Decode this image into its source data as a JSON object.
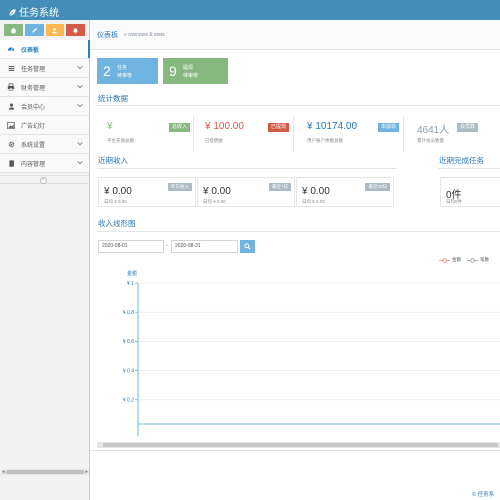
{
  "app": {
    "title": "任务系统"
  },
  "sidebar": {
    "shortcuts": [
      {
        "icon": "home-icon",
        "color": "#87b87f"
      },
      {
        "icon": "pencil-icon",
        "color": "#6fb3e0"
      },
      {
        "icon": "users-icon",
        "color": "#ffb752"
      },
      {
        "icon": "bell-icon",
        "color": "#d15b47"
      }
    ],
    "items": [
      {
        "label": "仪表板",
        "icon": "dashboard-icon",
        "active": true
      },
      {
        "label": "任务管理",
        "icon": "list-icon"
      },
      {
        "label": "财务管理",
        "icon": "print-icon"
      },
      {
        "label": "会员中心",
        "icon": "user-icon"
      },
      {
        "label": "广告幻灯",
        "icon": "picture-icon"
      },
      {
        "label": "系统设置",
        "icon": "gear-icon"
      },
      {
        "label": "内容管理",
        "icon": "book-icon"
      }
    ]
  },
  "breadcrumb": {
    "title": "仪表板",
    "subtitle": "» overview & stats"
  },
  "infoboxes": [
    {
      "number": "2",
      "title": "任务",
      "caption": "待审核",
      "color": "#6fb3e0"
    },
    {
      "number": "9",
      "title": "提现",
      "caption": "待审核",
      "color": "#87b87f"
    }
  ],
  "stats": {
    "title": "统计数据",
    "items": [
      {
        "value": "¥",
        "caption": "平台充值总额",
        "tag": "总收入",
        "color": "#87b87f"
      },
      {
        "value": "¥ 100.00",
        "caption": "已提佣金",
        "tag": "已提现",
        "color": "#d15b47"
      },
      {
        "value": "¥ 10174.00",
        "caption": "用户账户余额总额",
        "tag": "未提现",
        "color": "#6fb3e0"
      },
      {
        "value": "4641人",
        "caption": "累计会员数量",
        "tag": "会员数",
        "color": "#abbac3"
      }
    ]
  },
  "recent_income": {
    "title": "近期收入",
    "cards": [
      {
        "value": "¥ 0.00",
        "caption": "日均 ¥ 0.00",
        "tag": "昨日收入"
      },
      {
        "value": "¥ 0.00",
        "caption": "日均 ¥ 0.00",
        "tag": "最近7日"
      },
      {
        "value": "¥ 0.00",
        "caption": "日均 ¥ 0.00",
        "tag": "最近30日"
      }
    ]
  },
  "recent_tasks": {
    "title": "近期完成任务",
    "cards": [
      {
        "value": "0件",
        "caption": "日均0件"
      }
    ]
  },
  "trend": {
    "title": "收入线形图",
    "date_from": "2020-08-01",
    "date_sep": "-",
    "date_to": "2020-08-31",
    "legend": [
      "金额",
      "笔数"
    ]
  },
  "chart_data": {
    "type": "line",
    "title": "收入线形图",
    "ylabel": "金额",
    "ylim": [
      0,
      1
    ],
    "y_ticks": [
      "¥ 1",
      "¥ 0.8",
      "¥ 0.6",
      "¥ 0.4",
      "¥ 0.2"
    ],
    "series": [
      {
        "name": "金额",
        "values": []
      },
      {
        "name": "笔数",
        "values": []
      }
    ],
    "legend_position": "top-right"
  },
  "footer": {
    "text": "© 任务系"
  }
}
